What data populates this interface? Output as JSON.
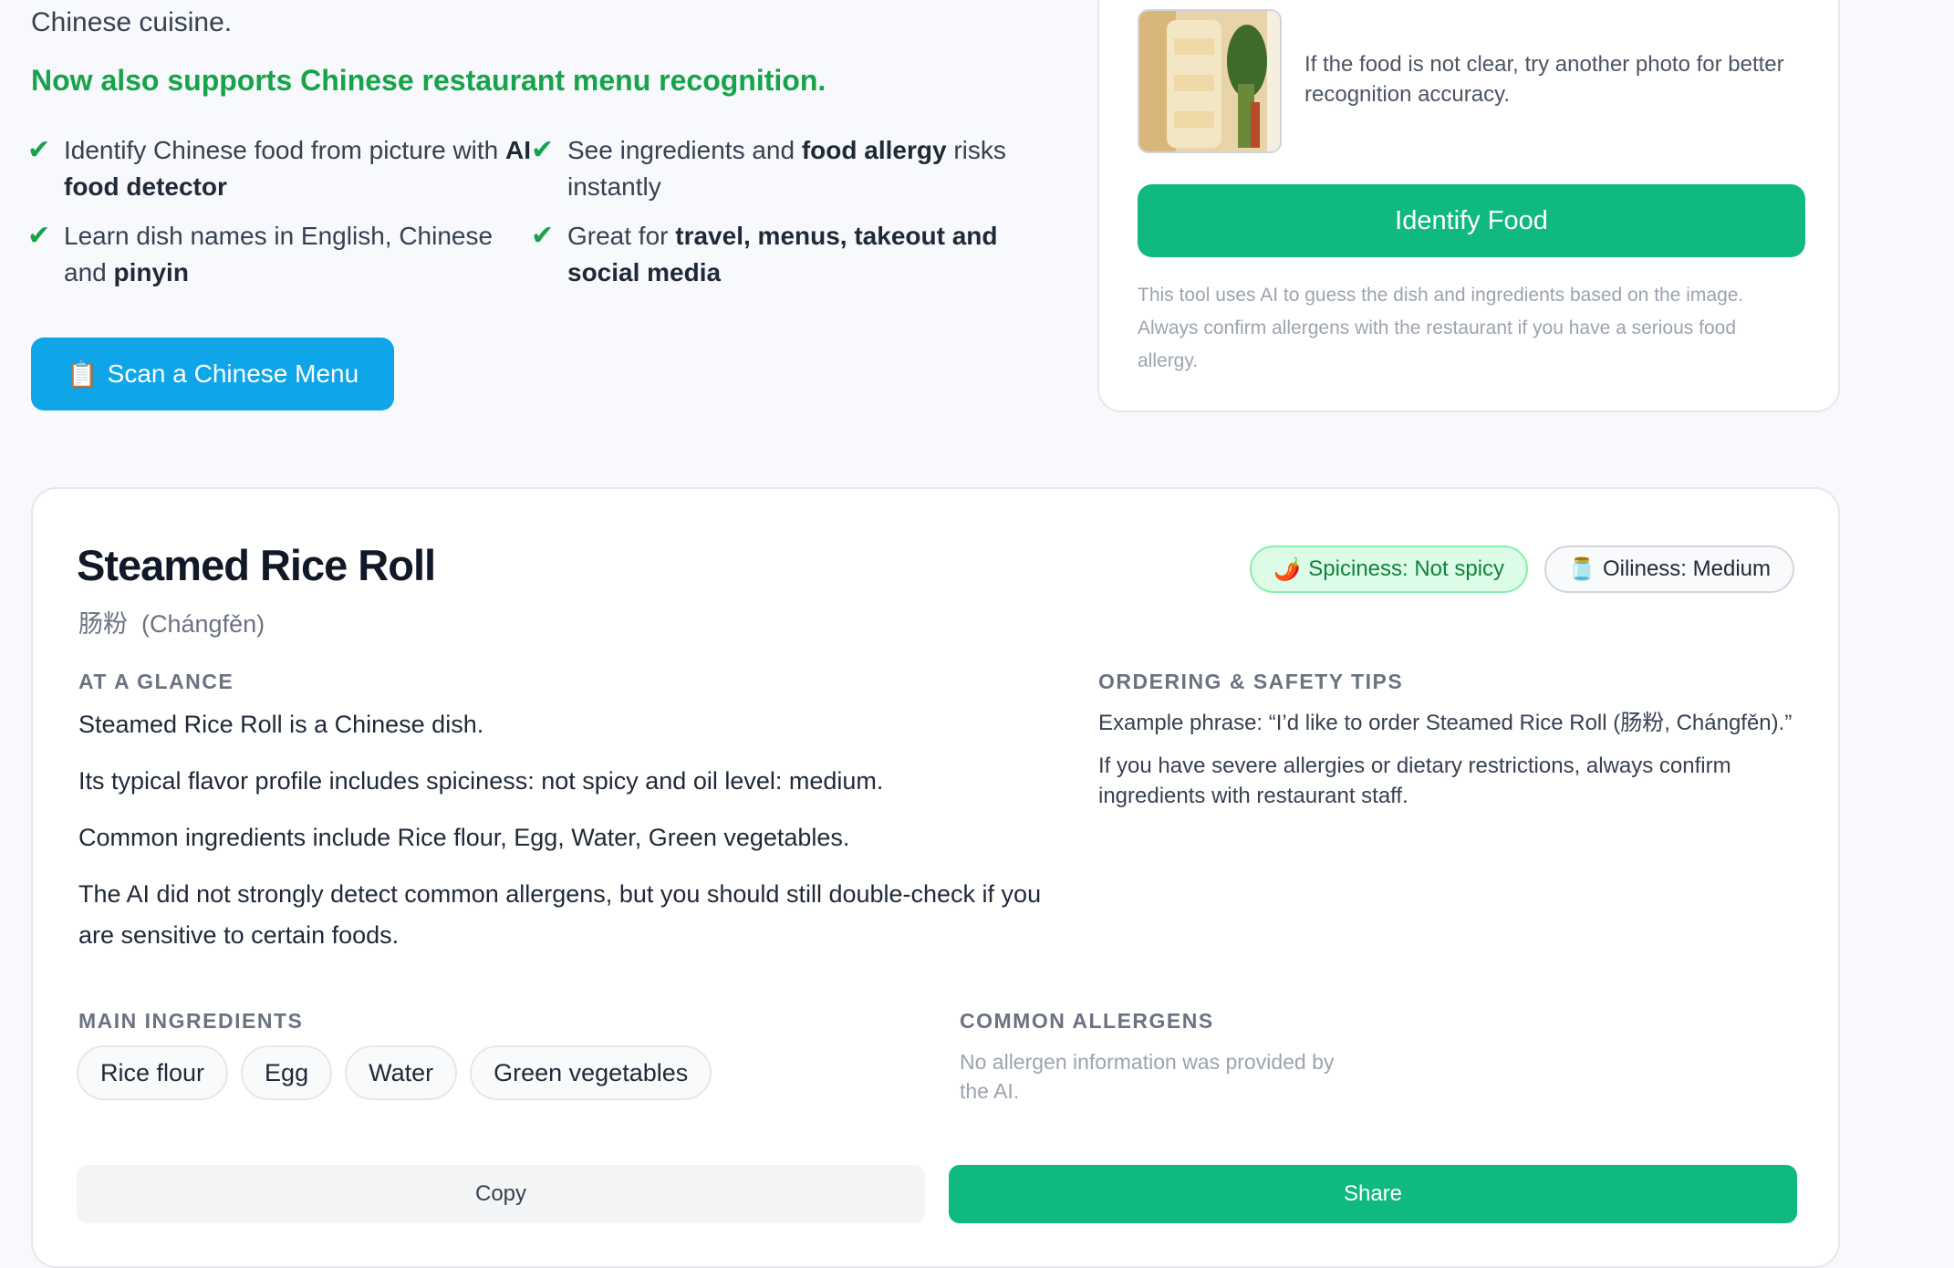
{
  "intro": {
    "tail_text": "Chinese cuisine.",
    "headline": "Now also supports Chinese restaurant menu recognition.",
    "features": [
      {
        "pre": "Identify Chinese food from picture with ",
        "bold": "AI food detector",
        "post": ""
      },
      {
        "pre": "See ingredients and ",
        "bold": "food allergy",
        "post": " risks instantly"
      },
      {
        "pre": "Learn dish names in English, Chinese and ",
        "bold": "pinyin",
        "post": ""
      },
      {
        "pre": "Great for ",
        "bold": "travel, menus, takeout and social media",
        "post": ""
      }
    ],
    "check_symbol": "✔",
    "scan_button": {
      "icon": "clipboard-icon",
      "icon_glyph": "📋",
      "label": "Scan a Chinese Menu"
    }
  },
  "upload": {
    "hint": "If the food is not clear, try another photo for better recognition accuracy.",
    "identify_label": "Identify Food",
    "disclaimer": "This tool uses AI to guess the dish and ingredients based on the image. Always confirm allergens with the restaurant if you have a serious food allergy."
  },
  "result": {
    "dish_name": "Steamed Rice Roll",
    "chinese": "肠粉",
    "pinyin": "(Chángfěn)",
    "badges": {
      "spicy": {
        "icon": "chili-icon",
        "glyph": "🌶️",
        "label": "Spiciness: Not spicy"
      },
      "oily": {
        "icon": "oil-bottle-icon",
        "glyph": "🫙",
        "label": "Oiliness: Medium"
      }
    },
    "glance_label": "AT A GLANCE",
    "glance": [
      "Steamed Rice Roll is a Chinese dish.",
      "Its typical flavor profile includes spiciness: not spicy and oil level: medium.",
      "Common ingredients include Rice flour, Egg, Water, Green vegetables.",
      "The AI did not strongly detect common allergens, but you should still double-check if you are sensitive to certain foods."
    ],
    "tips_label": "ORDERING & SAFETY TIPS",
    "tips": [
      "Example phrase: “I’d like to order Steamed Rice Roll (肠粉, Chángfěn).”",
      "If you have severe allergies or dietary restrictions, always confirm ingredients with restaurant staff."
    ],
    "ingredients_label": "MAIN INGREDIENTS",
    "ingredients": [
      "Rice flour",
      "Egg",
      "Water",
      "Green vegetables"
    ],
    "allergens_label": "COMMON ALLERGENS",
    "allergens_note": "No allergen information was provided by the AI.",
    "copy_label": "Copy",
    "share_label": "Share"
  },
  "colors": {
    "accent_green": "#10b981",
    "headline_green": "#16a34a",
    "scan_blue": "#0ea5e9"
  }
}
